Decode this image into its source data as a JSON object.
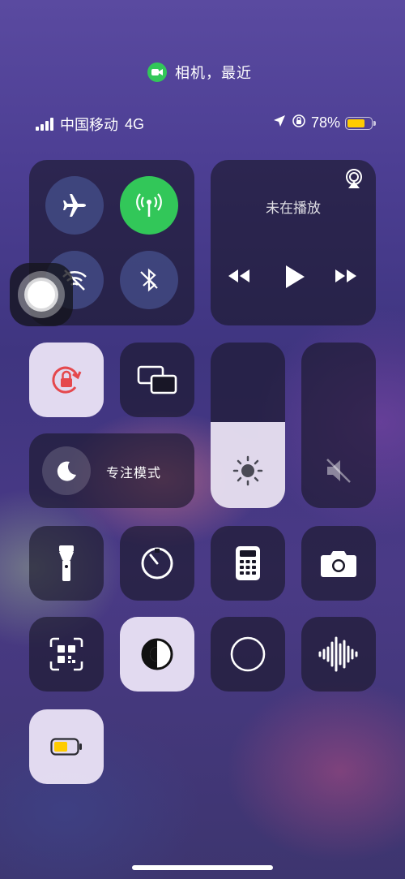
{
  "indicator": {
    "icon": "video-camera-icon",
    "text": "相机，最近",
    "color": "#32c759"
  },
  "status_bar": {
    "carrier": "中国移动",
    "network": "4G",
    "battery_percent": "78%",
    "battery_level": 0.78,
    "battery_color": "#ffcc00"
  },
  "connectivity": {
    "airplane": {
      "icon": "airplane-icon",
      "on": false
    },
    "cellular": {
      "icon": "cellular-antenna-icon",
      "on": true,
      "color": "#32c759"
    },
    "wifi": {
      "icon": "wifi-off-icon",
      "on": false
    },
    "bluetooth": {
      "icon": "bluetooth-off-icon",
      "on": false
    }
  },
  "media": {
    "status": "未在播放",
    "airplay_icon": "airplay-icon"
  },
  "focus": {
    "label": "专注模式",
    "icon": "moon-icon"
  },
  "brightness": {
    "level": 0.52,
    "icon": "sun-icon"
  },
  "volume": {
    "level": 0.0,
    "icon": "speaker-muted-icon"
  },
  "shortcuts": [
    "orientation-lock-icon",
    "screen-mirroring-icon",
    "flashlight-icon",
    "timer-icon",
    "calculator-icon",
    "camera-icon",
    "qr-code-scanner-icon",
    "dark-mode-icon",
    "screen-record-icon",
    "sound-recognition-icon",
    "low-power-battery-icon"
  ]
}
